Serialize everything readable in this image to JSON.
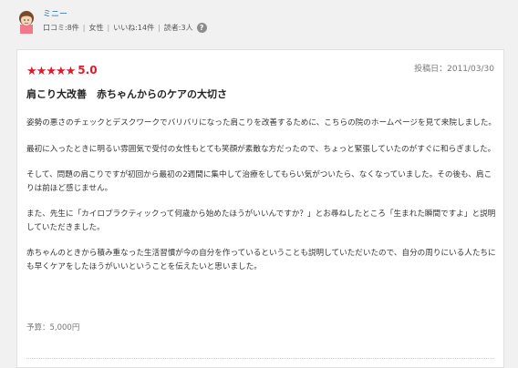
{
  "user": {
    "name": "ミニー",
    "meta": [
      "口コミ:8件",
      "女性",
      "いいね:14件",
      "読者:3人"
    ],
    "help_icon": "?"
  },
  "review": {
    "star_count": 5,
    "star_glyph": "★",
    "rating": "5.0",
    "date": "投稿日：2011/03/30",
    "title": "肩こり大改善　赤ちゃんからのケアの大切さ",
    "paragraphs": [
      "姿勢の悪さのチェックとデスクワークでバリバリになった肩こりを改善するために、こちらの院のホームページを見て来院しました。",
      "最初に入ったときに明るい雰囲気で受付の女性もとても笑顔が素敵な方だったので、ちょっと緊張していたのがすぐに和らぎました。",
      "そして、問題の肩こりですが初回から最初の2週間に集中して治療をしてもらい気がついたら、なくなっていました。その後も、肩こりは前ほど感じません。",
      "また、先生に「カイロプラクティックって何歳から始めたほうがいいんですか？」とお尋ねしたところ「生まれた瞬間ですよ」と説明していただきました。",
      "赤ちゃんのときから積み重なった生活習慣が今の自分を作っているということも説明していただいたので、自分の周りにいる人たちにも早くケアをしたほうがいいということを伝えたいと思いました。"
    ],
    "budget": "予算：5,000円"
  },
  "colors": {
    "star": "#e01a2a",
    "username": "#2a6aa6"
  }
}
